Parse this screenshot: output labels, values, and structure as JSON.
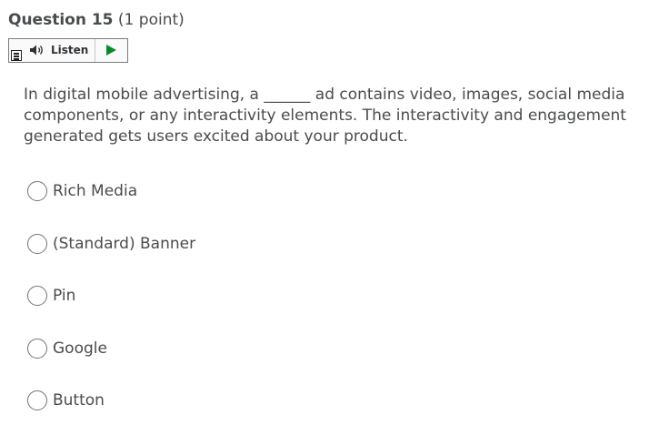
{
  "question": {
    "title": "Question 15",
    "points": "(1 point)"
  },
  "listen_bar": {
    "label": "Listen",
    "icons": {
      "menu": "menu-icon",
      "speaker": "speaker-icon",
      "play": "play-icon"
    },
    "play_color": "#0b8a2d"
  },
  "prompt": {
    "lines": [
      "In digital mobile advertising, a ______ ad contains video, images, social media",
      "components, or any interactivity elements.  The interactivity and engagement",
      "generated gets users excited about your product."
    ]
  },
  "options": [
    {
      "label": "Rich Media"
    },
    {
      "label": "(Standard) Banner"
    },
    {
      "label": "Pin"
    },
    {
      "label": "Google"
    },
    {
      "label": "Button"
    }
  ]
}
